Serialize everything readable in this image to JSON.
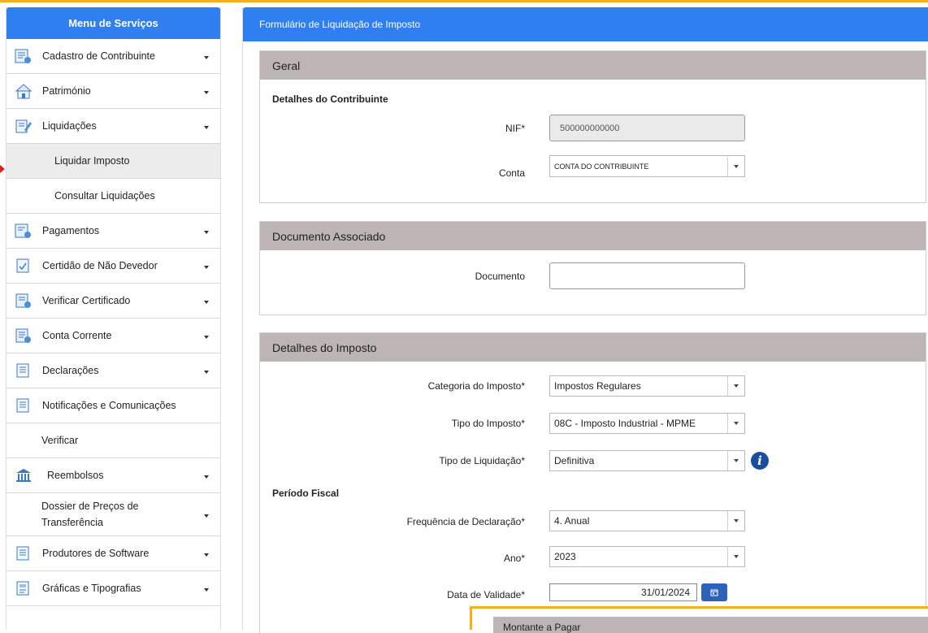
{
  "sidebar": {
    "header": "Menu de Serviços",
    "items": [
      {
        "label": "Cadastro de Contribuinte",
        "icon": "register-form-icon"
      },
      {
        "label": "Património",
        "icon": "house-icon"
      },
      {
        "label": "Liquidações",
        "icon": "document-edit-icon"
      },
      {
        "label": "Liquidar Imposto"
      },
      {
        "label": "Consultar Liquidações"
      },
      {
        "label": "Pagamentos",
        "icon": "payment-form-icon"
      },
      {
        "label": "Certidão de Não Devedor",
        "icon": "certificate-check-icon"
      },
      {
        "label": "Verificar Certificado",
        "icon": "verify-certificate-icon"
      },
      {
        "label": "Conta Corrente",
        "icon": "account-ledger-icon"
      },
      {
        "label": "Declarações",
        "icon": "declarations-doc-icon"
      },
      {
        "label": "Notificações e Comunicações",
        "icon": "notifications-doc-icon"
      },
      {
        "label": "Verificar"
      },
      {
        "label": "Reembolsos",
        "icon": "bank-icon"
      },
      {
        "label": "Dossier de Preços de Transferência"
      },
      {
        "label": "Produtores de Software",
        "icon": "software-doc-icon"
      },
      {
        "label": "Gráficas e Tipografias",
        "icon": "printing-doc-icon"
      }
    ]
  },
  "main": {
    "title": "Formulário de Liquidação de Imposto",
    "geral": {
      "heading": "Geral",
      "subheading": "Detalhes do Contribuinte",
      "nif_label": "NIF*",
      "nif_value": "500000000000",
      "conta_label": "Conta",
      "conta_value": "CONTA DO CONTRIBUINTE"
    },
    "documento": {
      "heading": "Documento Associado",
      "documento_label": "Documento",
      "documento_value": ""
    },
    "imposto": {
      "heading": "Detalhes do Imposto",
      "categoria_label": "Categoria do Imposto*",
      "categoria_value": "Impostos Regulares",
      "tipo_label": "Tipo do Imposto*",
      "tipo_value": "08C - Imposto Industrial - MPME",
      "liquidacao_label": "Tipo de Liquidação*",
      "liquidacao_value": "Definitiva",
      "info_glyph": "i",
      "periodo_label": "Período Fiscal",
      "frequencia_label": "Frequência de Declaração*",
      "frequencia_value": "4. Anual",
      "ano_label": "Ano*",
      "ano_value": "2023",
      "validade_label": "Data de Validade*",
      "validade_value": "31/01/2024"
    },
    "overlay_heading": "Montante a Pagar"
  },
  "colors": {
    "brand_blue": "#2f7ff0",
    "panel_header": "#bdb5b5",
    "highlight": "#f3b21c",
    "date_button": "#2a63b7",
    "info_button": "#1a4e9c"
  }
}
